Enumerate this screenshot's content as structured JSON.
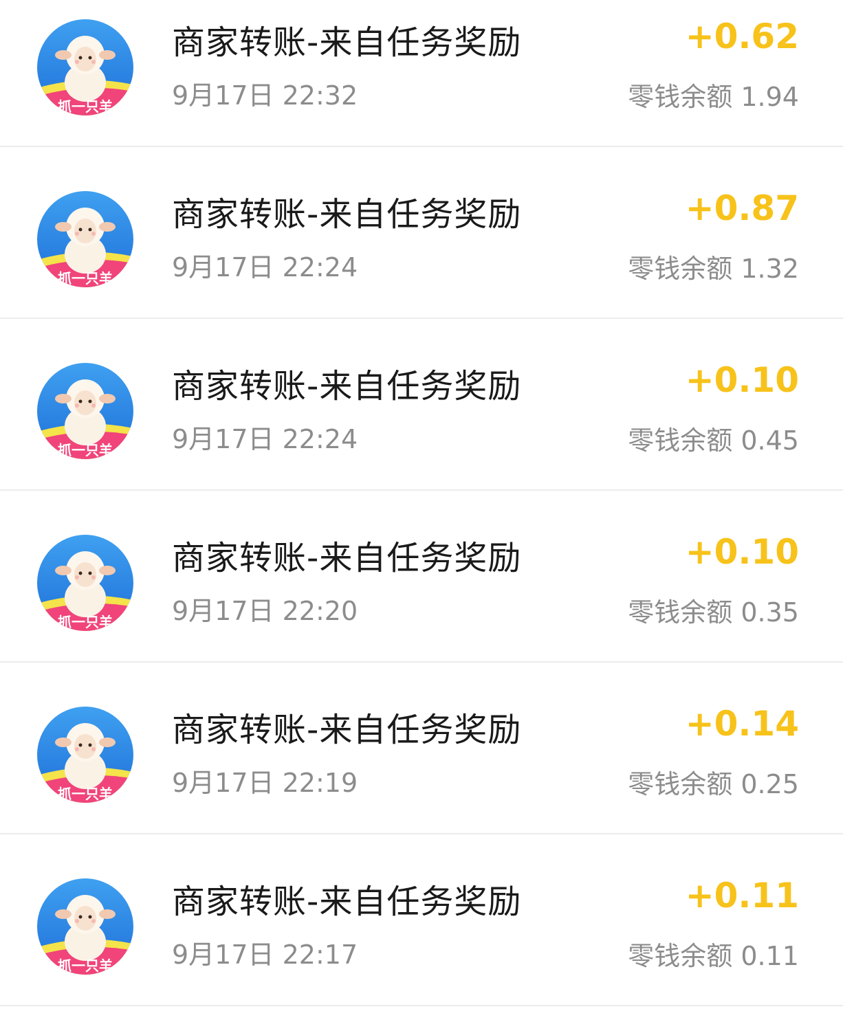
{
  "accent_color": "#f7c21a",
  "transactions": [
    {
      "title": "商家转账-来自任务奖励",
      "time": "9月17日 22:32",
      "amount": "+0.62",
      "balance_label": "零钱余额 1.94",
      "avatar_icon": "sheep-avatar-icon",
      "avatar_caption": "抓一只羊"
    },
    {
      "title": "商家转账-来自任务奖励",
      "time": "9月17日 22:24",
      "amount": "+0.87",
      "balance_label": "零钱余额 1.32",
      "avatar_icon": "sheep-avatar-icon",
      "avatar_caption": "抓一只羊"
    },
    {
      "title": "商家转账-来自任务奖励",
      "time": "9月17日 22:24",
      "amount": "+0.10",
      "balance_label": "零钱余额 0.45",
      "avatar_icon": "sheep-avatar-icon",
      "avatar_caption": "抓一只羊"
    },
    {
      "title": "商家转账-来自任务奖励",
      "time": "9月17日 22:20",
      "amount": "+0.10",
      "balance_label": "零钱余额 0.35",
      "avatar_icon": "sheep-avatar-icon",
      "avatar_caption": "抓一只羊"
    },
    {
      "title": "商家转账-来自任务奖励",
      "time": "9月17日 22:19",
      "amount": "+0.14",
      "balance_label": "零钱余额 0.25",
      "avatar_icon": "sheep-avatar-icon",
      "avatar_caption": "抓一只羊"
    },
    {
      "title": "商家转账-来自任务奖励",
      "time": "9月17日 22:17",
      "amount": "+0.11",
      "balance_label": "零钱余额 0.11",
      "avatar_icon": "sheep-avatar-icon",
      "avatar_caption": "抓一只羊"
    }
  ]
}
